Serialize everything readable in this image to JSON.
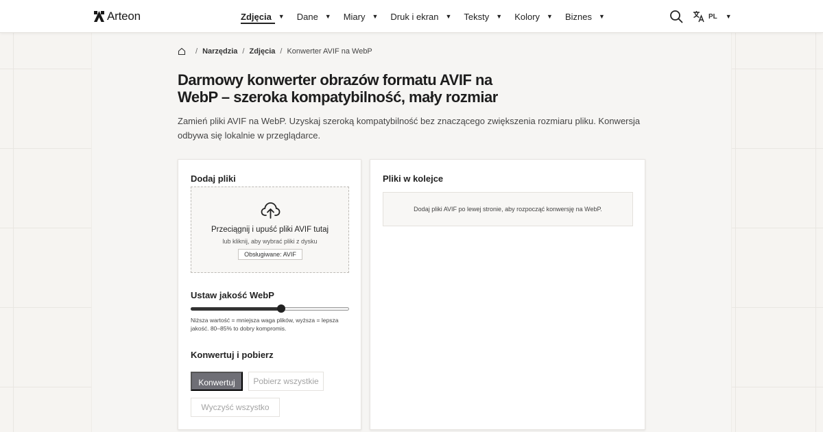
{
  "header": {
    "logo_text": "Arteon",
    "nav": [
      {
        "label": "Zdjęcia",
        "active": true
      },
      {
        "label": "Dane",
        "active": false
      },
      {
        "label": "Miary",
        "active": false
      },
      {
        "label": "Druk i ekran",
        "active": false
      },
      {
        "label": "Teksty",
        "active": false
      },
      {
        "label": "Kolory",
        "active": false
      },
      {
        "label": "Biznes",
        "active": false
      }
    ],
    "caret": "▼",
    "search_icon": "search-icon",
    "language": {
      "icon": "translate-icon",
      "code": "PL"
    }
  },
  "breadcrumb": {
    "home_icon": "home-icon",
    "separator": "/",
    "items": [
      "Narzędzia",
      "Zdjęcia"
    ],
    "current": "Konwerter AVIF na WebP"
  },
  "page": {
    "title": "Darmowy konwerter obrazów formatu AVIF na WebP – szeroka kompatybilność, mały rozmiar",
    "description": "Zamień pliki AVIF na WebP. Uzyskaj szeroką kompatybilność bez znaczącego zwiększenia rozmiaru pliku. Konwersja odbywa się lokalnie w przeglądarce."
  },
  "upload": {
    "section_title": "Dodaj pliki",
    "icon": "cloud-upload-icon",
    "dropzone_main": "Przeciągnij i upuść pliki AVIF tutaj",
    "dropzone_sub": "lub kliknij, aby wybrać pliki z dysku",
    "supported_badge": "Obsługiwane: AVIF"
  },
  "quality": {
    "section_title": "Ustaw jakość WebP",
    "value_fraction": 0.57,
    "hint": "Niższa wartość = mniejsza waga plików, wyższa = lepsza jakość. 80–85% to dobry kompromis."
  },
  "actions": {
    "section_title": "Konwertuj i pobierz",
    "convert_label": "Konwertuj",
    "download_all_label": "Pobierz wszystkie",
    "clear_all_label": "Wyczyść wszystko"
  },
  "queue": {
    "section_title": "Pliki w kolejce",
    "empty_message": "Dodaj pliki AVIF po lewej stronie, aby rozpocząć konwersję na WebP."
  },
  "colors": {
    "primary_button": "#6f6f76",
    "background": "#f6f4f1",
    "text": "#222222"
  }
}
